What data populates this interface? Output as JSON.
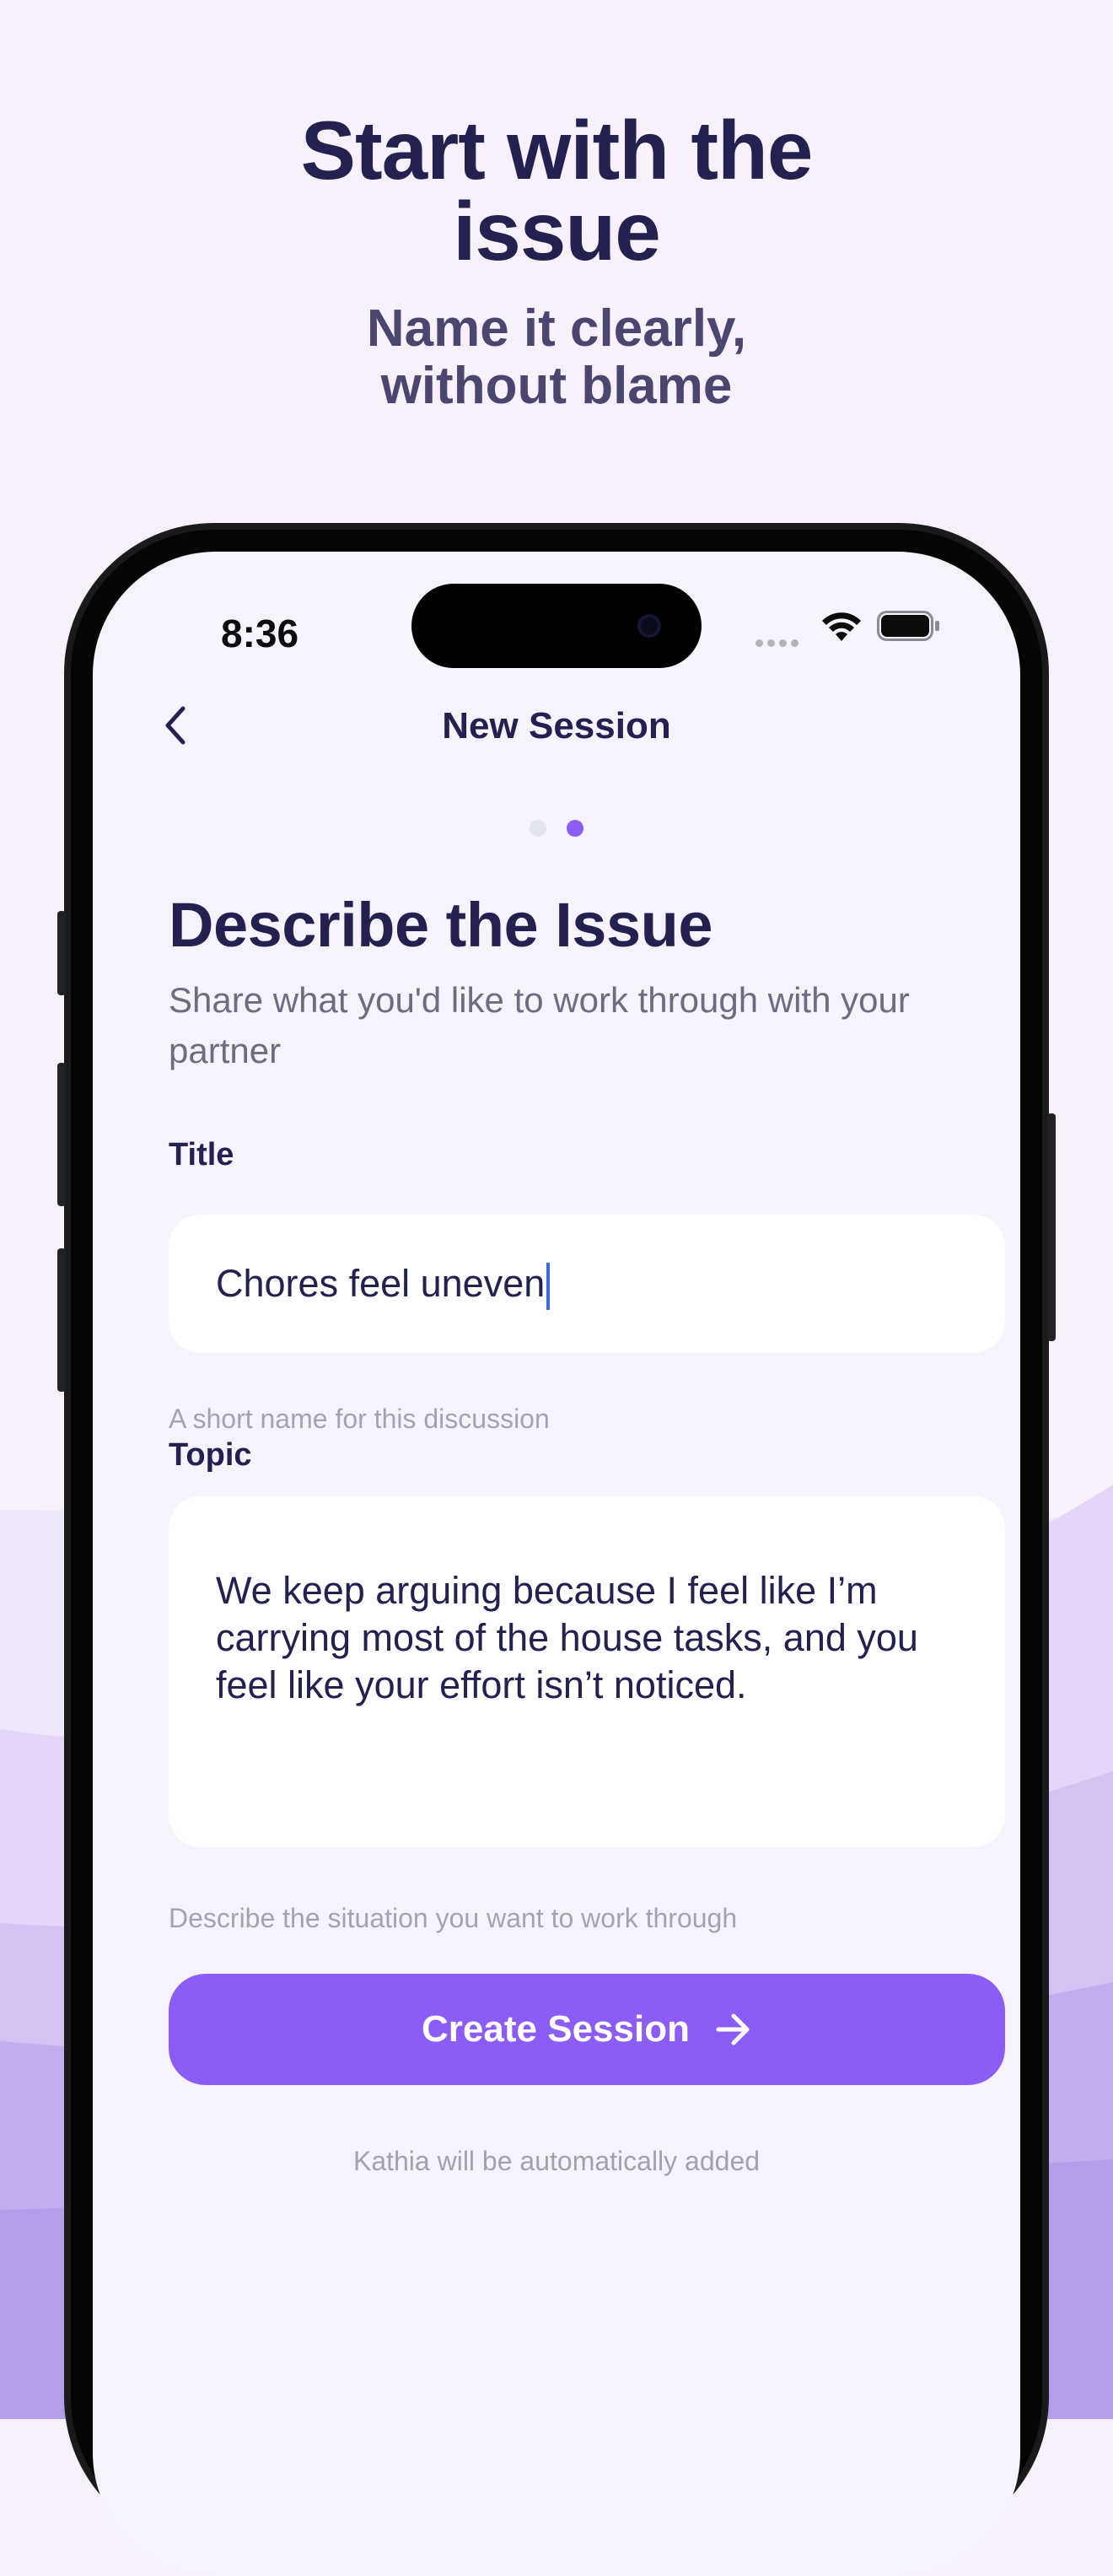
{
  "marketing": {
    "headline_line1": "Start with the",
    "headline_line2": "issue",
    "subhead_line1": "Name it clearly,",
    "subhead_line2": "without blame"
  },
  "status_bar": {
    "time": "8:36",
    "icons": [
      "cellular-signal-icon",
      "wifi-icon",
      "battery-icon"
    ]
  },
  "nav": {
    "back_icon": "chevron-left-icon",
    "title": "New Session"
  },
  "progress": {
    "total_steps": 2,
    "current_step": 2,
    "inactive_color": "#e2e4ee",
    "active_color": "#8b5cf6"
  },
  "page": {
    "heading": "Describe the Issue",
    "description": "Share what you'd like to work through with your partner"
  },
  "form": {
    "title_label": "Title",
    "title_value": "Chores feel uneven",
    "title_hint": "A short name for this discussion",
    "topic_label": "Topic",
    "topic_value": "We keep arguing because I feel like I’m carrying most of the house tasks, and you feel like your effort isn’t noticed.",
    "topic_hint": "Describe the situation you want to work through"
  },
  "cta": {
    "label": "Create Session",
    "icon": "arrow-right-icon",
    "color": "#8b5cf6"
  },
  "footnote": "Kathia will be automatically added",
  "colors": {
    "text_primary": "#22214f",
    "background": "#f8f1fb",
    "screen_background": "#f6f3fd",
    "accent": "#8b5cf6"
  }
}
